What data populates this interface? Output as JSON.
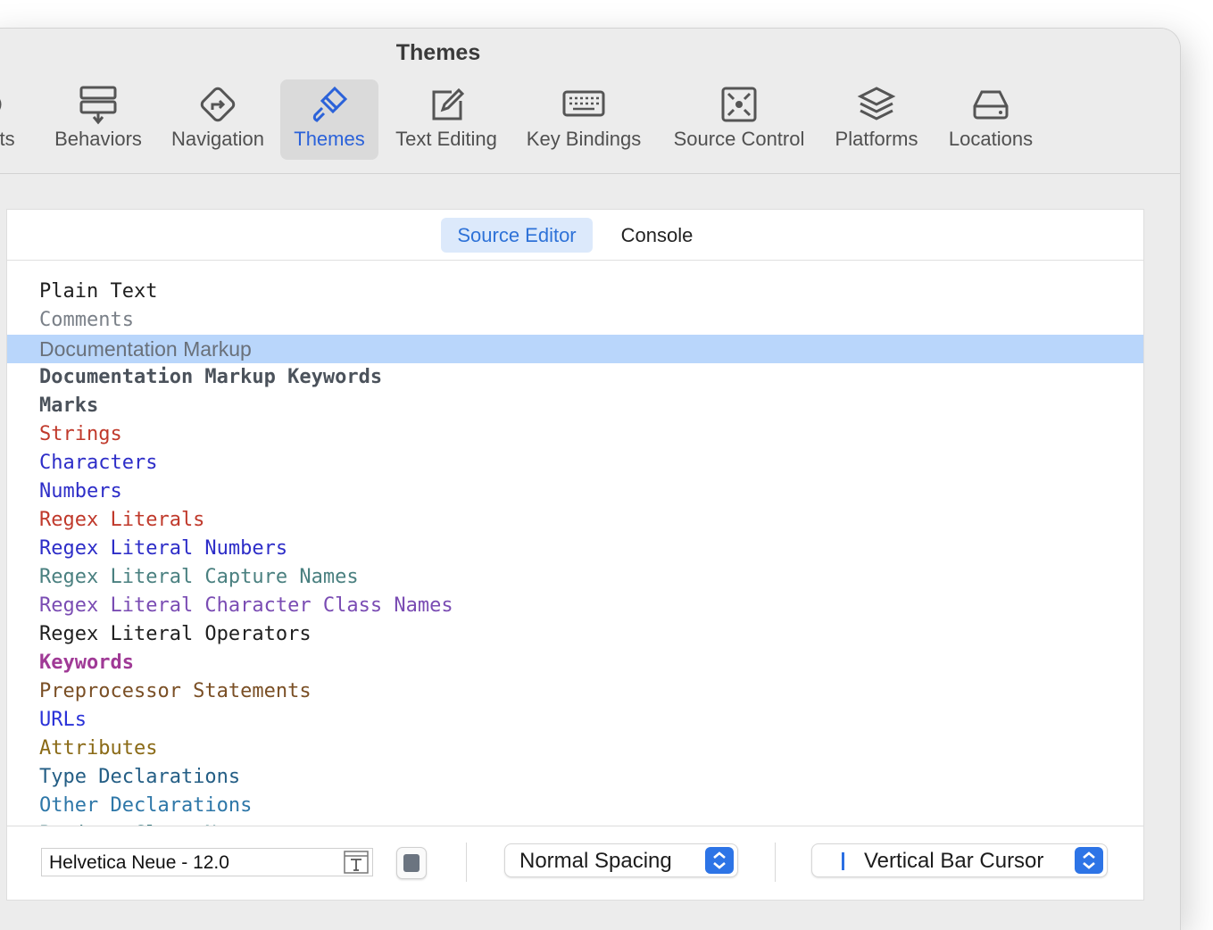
{
  "window": {
    "title": "Themes"
  },
  "toolbar": {
    "items": [
      {
        "label": "nts",
        "icon": "partial-icon"
      },
      {
        "label": "Behaviors",
        "icon": "behaviors-icon"
      },
      {
        "label": "Navigation",
        "icon": "navigation-icon"
      },
      {
        "label": "Themes",
        "icon": "paintbrush-icon",
        "active": true
      },
      {
        "label": "Text Editing",
        "icon": "text-editing-icon"
      },
      {
        "label": "Key Bindings",
        "icon": "keyboard-icon"
      },
      {
        "label": "Source Control",
        "icon": "source-control-icon"
      },
      {
        "label": "Platforms",
        "icon": "stack-icon"
      },
      {
        "label": "Locations",
        "icon": "drive-icon"
      }
    ]
  },
  "segments": {
    "source_editor": "Source Editor",
    "console": "Console",
    "active": "Source Editor"
  },
  "syntax_items": [
    {
      "label": "Plain Text",
      "color": "#1f1f1f"
    },
    {
      "label": "Comments",
      "color": "#7a8088"
    },
    {
      "label": "Documentation Markup",
      "color": "#69707a",
      "selected": true
    },
    {
      "label": "Documentation Markup Keywords",
      "color": "#4b525b",
      "bold": true
    },
    {
      "label": "Marks",
      "color": "#4b525b",
      "bold": true
    },
    {
      "label": "Strings",
      "color": "#c0392b"
    },
    {
      "label": "Characters",
      "color": "#2d2dc8"
    },
    {
      "label": "Numbers",
      "color": "#2d2dc8"
    },
    {
      "label": "Regex Literals",
      "color": "#c0392b"
    },
    {
      "label": "Regex Literal Numbers",
      "color": "#2d2dc8"
    },
    {
      "label": "Regex Literal Capture Names",
      "color": "#4a8080"
    },
    {
      "label": "Regex Literal Character Class Names",
      "color": "#7a4cb3"
    },
    {
      "label": "Regex Literal Operators",
      "color": "#1f1f1f"
    },
    {
      "label": "Keywords",
      "color": "#a03a96",
      "bold": true
    },
    {
      "label": "Preprocessor Statements",
      "color": "#7a4f25"
    },
    {
      "label": "URLs",
      "color": "#2a32d8"
    },
    {
      "label": "Attributes",
      "color": "#8a6a16"
    },
    {
      "label": "Type Declarations",
      "color": "#245e85"
    },
    {
      "label": "Other Declarations",
      "color": "#2e77a8"
    },
    {
      "label": "Project Class Names",
      "color": "#3b7a80"
    }
  ],
  "footer": {
    "font": "Helvetica Neue - 12.0",
    "swatch_color": "#6b7480",
    "spacing": "Normal Spacing",
    "cursor": "Vertical Bar Cursor"
  }
}
